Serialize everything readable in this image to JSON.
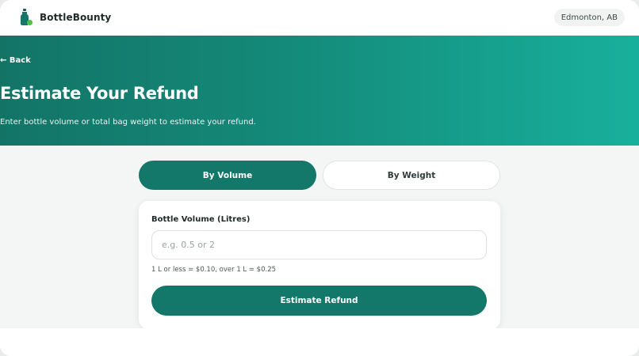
{
  "header": {
    "brand_name": "BottleBounty",
    "location": "Edmonton, AB"
  },
  "hero": {
    "back_label": "← Back",
    "title": "Estimate Your Refund",
    "subtitle": "Enter bottle volume or total bag weight to estimate your refund."
  },
  "tabs": [
    {
      "label": "By Volume",
      "active": true
    },
    {
      "label": "By Weight",
      "active": false
    }
  ],
  "form": {
    "field_label": "Bottle Volume (Litres)",
    "input_value": "",
    "input_placeholder": "e.g. 0.5 or 2",
    "hint": "1 L or less = $0.10, over 1 L = $0.25",
    "submit_label": "Estimate Refund"
  },
  "colors": {
    "brand": "#13776a",
    "accent": "#18b09c",
    "logo_dot": "#4cc04a"
  },
  "icons": {
    "logo": "bottle-logo-icon"
  }
}
